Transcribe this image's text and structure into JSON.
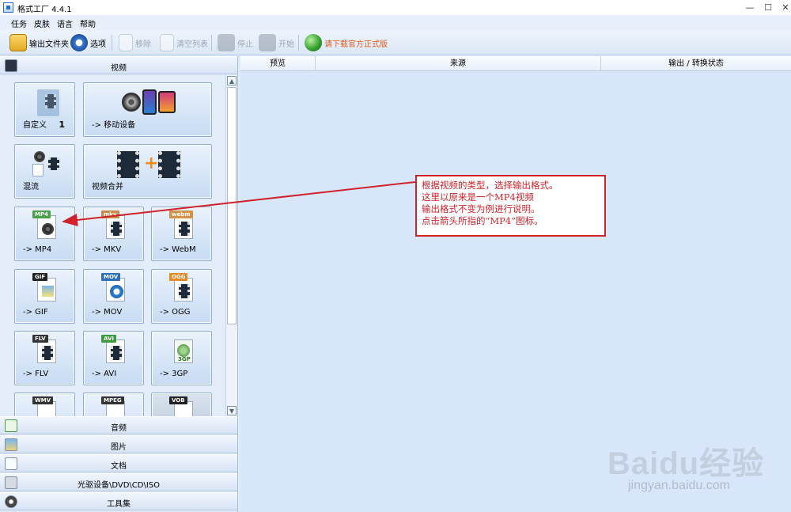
{
  "window": {
    "title": "格式工厂 4.4.1",
    "controls": {
      "minimize": "—",
      "maximize": "☐",
      "close": "✕"
    }
  },
  "menu": [
    "任务",
    "皮肤",
    "语言",
    "帮助"
  ],
  "toolbar": {
    "output_folder": "输出文件夹",
    "options": "选项",
    "remove": "移除",
    "clear_list": "清空列表",
    "stop": "停止",
    "start": "开始",
    "download": "请下载官方正式版"
  },
  "left": {
    "video_header": "视频",
    "tiles": {
      "custom": {
        "label": "自定义",
        "count": "1"
      },
      "mobile": {
        "label": "-> 移动设备"
      },
      "mix": {
        "label": "混流"
      },
      "merge": {
        "label": "视频合并"
      },
      "mp4": {
        "label": "-> MP4",
        "badge": "MP4"
      },
      "mkv": {
        "label": "-> MKV",
        "badge": "mkv"
      },
      "webm": {
        "label": "-> WebM",
        "badge": "webm"
      },
      "gif": {
        "label": "-> GIF",
        "badge": "GIF"
      },
      "mov": {
        "label": "-> MOV",
        "badge": "MOV"
      },
      "ogg": {
        "label": "-> OGG",
        "badge": "OGG"
      },
      "flv": {
        "label": "-> FLV",
        "badge": "FLV"
      },
      "avi": {
        "label": "-> AVI",
        "badge": "AVI"
      },
      "3gp": {
        "label": "-> 3GP",
        "badge": "3GP"
      },
      "wmv": {
        "badge": "WMV"
      },
      "mpeg": {
        "badge": "MPEG"
      },
      "vob": {
        "badge": "VOB"
      }
    },
    "categories": {
      "audio": "音频",
      "image": "图片",
      "document": "文档",
      "disc": "光驱设备\\DVD\\CD\\ISO",
      "tools": "工具集"
    }
  },
  "table": {
    "columns": [
      "预览",
      "来源",
      "输出 / 转换状态"
    ]
  },
  "annotation": {
    "lines": [
      "根据视频的类型，选择输出格式。",
      "这里以原来是一个MP4视频",
      "输出格式不变为例进行说明。",
      "点击箭头所指的“MP4”图标。"
    ],
    "color": "#d0222a"
  },
  "watermark": {
    "brand": "Baidu经验",
    "url": "jingyan.baidu.com"
  },
  "colors": {
    "accent_orange": "#e2591b",
    "tile_border": "#90acd2"
  }
}
